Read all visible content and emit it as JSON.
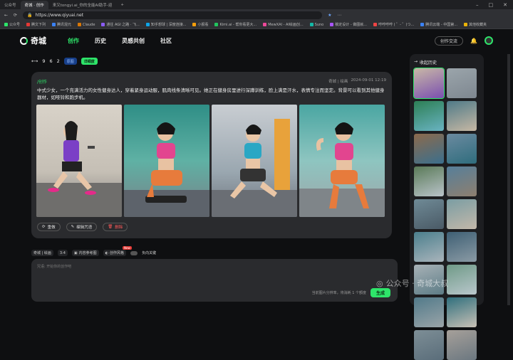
{
  "browser": {
    "tabs": [
      {
        "label": "公众号",
        "active": false
      },
      {
        "label": "奇城 · 创作",
        "active": true
      },
      {
        "label": "来又tongyi.ai_你的全能AI助手-迎",
        "active": false
      }
    ],
    "url": "https://www.qiyuai.net",
    "bookmarks": [
      "公众号",
      "腾文下列",
      "腾讯混元",
      "Claude",
      "通往 AGI 之路 · 飞...",
      "知乎想球 | 深度连接...",
      "小报看",
      "Kimi.ai - 帮你看更大...",
      "MewXAI - AI绘画创...",
      "Suno",
      "稿定设计 - 做图就...",
      "哼哼哼哼 ( ゜- ゜)つ...",
      "腾讯云端 - 中国第...",
      "其他收藏夹"
    ]
  },
  "nav": {
    "logo": "奇城",
    "links": [
      {
        "label": "创作",
        "active": true
      },
      {
        "label": "历史",
        "active": false
      },
      {
        "label": "灵感共创",
        "active": false
      },
      {
        "label": "社区",
        "active": false
      }
    ],
    "exchange_button": "创作交流"
  },
  "toolbar": {
    "counts": [
      "9",
      "6",
      "2"
    ],
    "tag_blue": "原图",
    "tag_green": "详细度"
  },
  "card": {
    "title": "/创作",
    "meta_author": "奇城 | 绘画",
    "meta_date": "2024-09-01 12:19",
    "prompt": "中式少女，一个充满活力的女性健身达人，穿着紧身运动服，肌肉线条清晰可见。她正在健身房里进行深蹲训练，脸上满是汗水，表情专注而坚定。背景可以看到其他健身器材，如哑铃和跑步机。",
    "actions": [
      {
        "label": "重做",
        "icon": "refresh-icon"
      },
      {
        "label": "编辑咒语",
        "icon": "edit-icon"
      },
      {
        "label": "删除",
        "icon": "trash-icon"
      }
    ]
  },
  "composer": {
    "model": "奇城 | 绘画",
    "count": "3:4",
    "chip_content": "内容参考图",
    "chip_style": "创作风格",
    "new_badge": "New",
    "toggle_label": "负向关键",
    "placeholder": "咒语: 开始你的创作吧",
    "hint": "当前图片分辨率，将消耗 1 个额度",
    "generate": "生成"
  },
  "history": {
    "title": "收起历史"
  },
  "watermark": "公众号 · 奇城大叔",
  "colors": {
    "accent": "#2ee56a",
    "danger": "#ff5a5a",
    "card": "#2a2b2e"
  }
}
